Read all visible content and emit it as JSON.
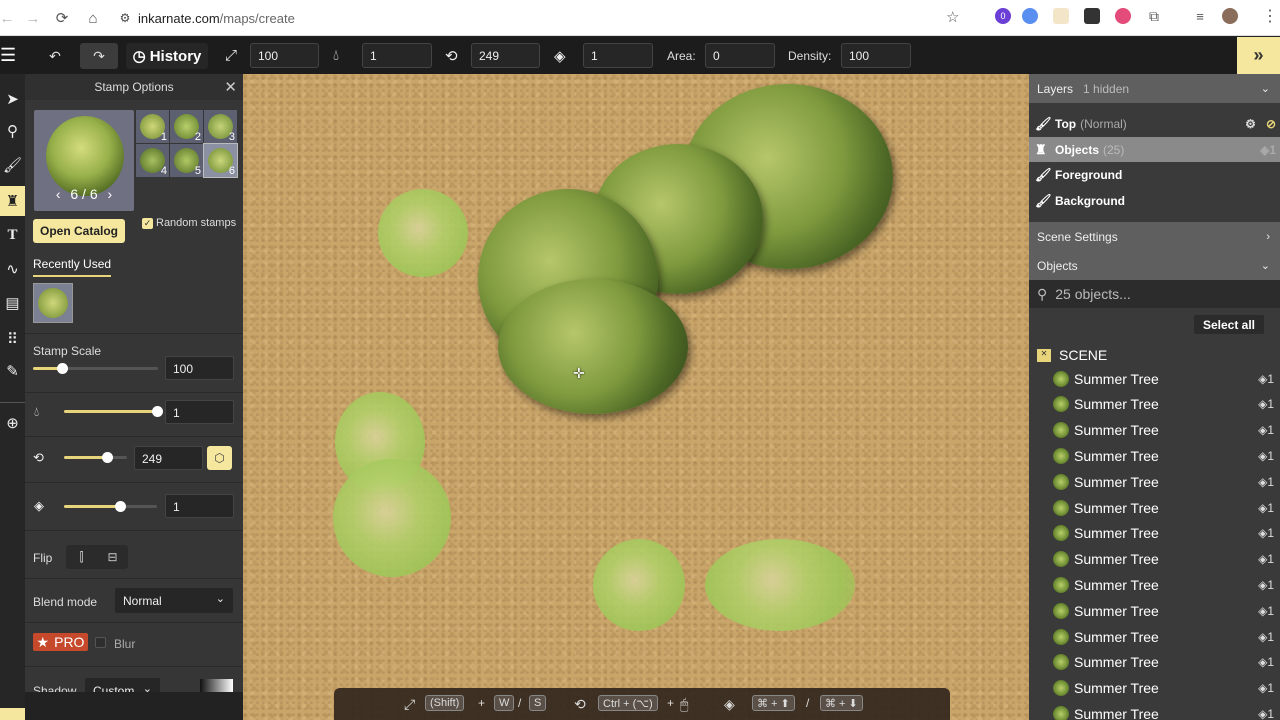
{
  "browser": {
    "url_domain": "inkarnate.com",
    "url_path": "/maps/create",
    "extension_badge": "0"
  },
  "toolbar": {
    "history_label": "History",
    "size_value": "100",
    "opacity_value": "1",
    "rotation_value": "249",
    "layer_value": "1",
    "area_label": "Area:",
    "area_value": "0",
    "density_label": "Density:",
    "density_value": "100",
    "expand_icon": "»"
  },
  "tool_rail": {
    "items": [
      "select",
      "pin",
      "brush",
      "stamp",
      "text",
      "path",
      "document",
      "grid",
      "magic-wand",
      "zoom"
    ],
    "active": "stamp"
  },
  "stamp_options": {
    "title": "Stamp Options",
    "pager": "6 / 6",
    "thumbnails": [
      "1",
      "2",
      "3",
      "4",
      "5",
      "6"
    ],
    "selected_thumbnail": "6",
    "open_catalog_label": "Open Catalog",
    "random_stamps_label": "Random stamps",
    "random_stamps_checked": true,
    "recently_used_label": "Recently Used",
    "stamp_scale_label": "Stamp Scale",
    "stamp_scale_value": "100",
    "stamp_scale_fraction": 0.23,
    "opacity_value": "1",
    "opacity_fraction": 1.0,
    "rotation_value": "249",
    "rotation_fraction": 0.69,
    "layer_value": "1",
    "layer_fraction": 0.6,
    "flip_label": "Flip",
    "blend_mode_label": "Blend mode",
    "blend_mode_value": "Normal",
    "pro_label": "PRO",
    "blur_label": "Blur",
    "blur_checked": false,
    "shadow_label": "Shadow",
    "shadow_value": "Custom"
  },
  "hint_bar": {
    "shift_key": "(Shift)",
    "plus": "+",
    "w_key": "W",
    "slash": "/",
    "s_key": "S",
    "ctrl_key": "Ctrl + (⌥)",
    "up_key": "⌘ + ⬆",
    "down_key": "⌘ + ⬇"
  },
  "layers_panel": {
    "title": "Layers",
    "hidden_count": "1 hidden",
    "layers": [
      {
        "name": "Top",
        "meta": "(Normal)"
      },
      {
        "name": "Objects",
        "meta": "(25)",
        "count": "1"
      },
      {
        "name": "Foreground",
        "meta": ""
      },
      {
        "name": "Background",
        "meta": ""
      }
    ],
    "scene_settings_label": "Scene Settings",
    "objects_label": "Objects",
    "search_placeholder": "25 objects...",
    "select_all_label": "Select all",
    "scene_label": "SCENE",
    "objects": [
      {
        "name": "Summer Tree",
        "layer": "1"
      },
      {
        "name": "Summer Tree",
        "layer": "1"
      },
      {
        "name": "Summer Tree",
        "layer": "1"
      },
      {
        "name": "Summer Tree",
        "layer": "1"
      },
      {
        "name": "Summer Tree",
        "layer": "1"
      },
      {
        "name": "Summer Tree",
        "layer": "1"
      },
      {
        "name": "Summer Tree",
        "layer": "1"
      },
      {
        "name": "Summer Tree",
        "layer": "1"
      },
      {
        "name": "Summer Tree",
        "layer": "1"
      },
      {
        "name": "Summer Tree",
        "layer": "1"
      },
      {
        "name": "Summer Tree",
        "layer": "1"
      },
      {
        "name": "Summer Tree",
        "layer": "1"
      },
      {
        "name": "Summer Tree",
        "layer": "1"
      },
      {
        "name": "Summer Tree",
        "layer": "1"
      }
    ]
  },
  "colors": {
    "accent_yellow": "#f5e79e",
    "pro_red": "#c6492c",
    "panel_bg": "#363636"
  }
}
